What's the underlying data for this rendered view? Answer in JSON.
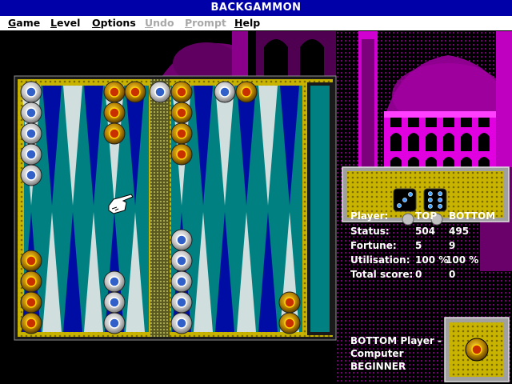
{
  "window": {
    "title": "BACKGAMMON"
  },
  "menu": [
    {
      "label": "Game",
      "enabled": true
    },
    {
      "label": "Level",
      "enabled": true
    },
    {
      "label": "Options",
      "enabled": true
    },
    {
      "label": "Undo",
      "enabled": false
    },
    {
      "label": "Prompt",
      "enabled": false
    },
    {
      "label": "Help",
      "enabled": true
    }
  ],
  "dice": {
    "values": [
      3,
      6
    ]
  },
  "stats": {
    "header": {
      "label": "Player:",
      "top": "TOP",
      "bottom": "BOTTOM"
    },
    "rows": [
      {
        "label": "Status:",
        "top": "504",
        "bottom": "495"
      },
      {
        "label": "Fortune:",
        "top": "5",
        "bottom": "9"
      },
      {
        "label": "Utilisation:",
        "top": "100 %",
        "bottom": "100 %"
      },
      {
        "label": "Total score:",
        "top": "0",
        "bottom": "0"
      }
    ]
  },
  "turn": {
    "line1": "BOTTOM Player -",
    "line2": "Computer",
    "line3": "BEGINNER"
  },
  "board": {
    "checker_colors": {
      "white": "#c8c8c8",
      "gold": "#a87800"
    },
    "top_points": [
      {
        "color": "white",
        "count": 5
      },
      {
        "color": "none",
        "count": 0
      },
      {
        "color": "none",
        "count": 0
      },
      {
        "color": "none",
        "count": 0
      },
      {
        "color": "gold",
        "count": 3
      },
      {
        "color": "gold",
        "count": 1
      },
      {
        "color": "gold",
        "count": 4
      },
      {
        "color": "none",
        "count": 0
      },
      {
        "color": "white",
        "count": 1
      },
      {
        "color": "gold",
        "count": 1
      },
      {
        "color": "none",
        "count": 0
      },
      {
        "color": "none",
        "count": 0
      }
    ],
    "bottom_points": [
      {
        "color": "gold",
        "count": 4
      },
      {
        "color": "none",
        "count": 0
      },
      {
        "color": "none",
        "count": 0
      },
      {
        "color": "none",
        "count": 0
      },
      {
        "color": "white",
        "count": 3
      },
      {
        "color": "none",
        "count": 0
      },
      {
        "color": "white",
        "count": 5
      },
      {
        "color": "none",
        "count": 0
      },
      {
        "color": "none",
        "count": 0
      },
      {
        "color": "none",
        "count": 0
      },
      {
        "color": "none",
        "count": 0
      },
      {
        "color": "gold",
        "count": 2
      }
    ],
    "bar_top": {
      "color": "white",
      "count": 1
    }
  }
}
